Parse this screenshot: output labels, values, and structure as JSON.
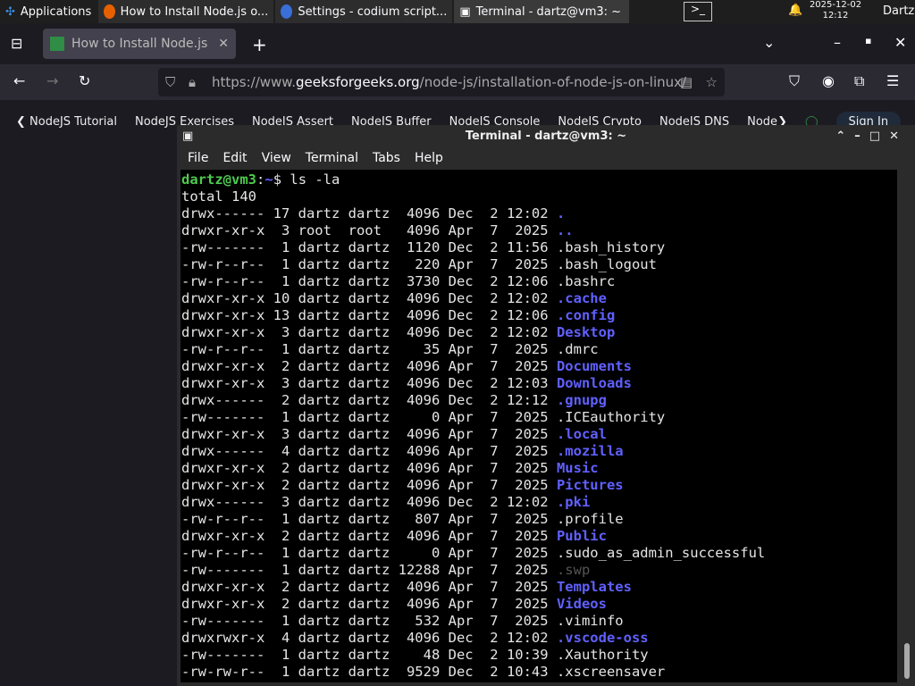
{
  "panel": {
    "apps": "Applications",
    "tasks": [
      "How to Install Node.js o...",
      "Settings - codium script...",
      "Terminal - dartz@vm3: ~"
    ],
    "date": "2025-12-02",
    "time": "12:12",
    "user": "Dartz"
  },
  "browser": {
    "tab_title": "How to Install Node.js or",
    "url_pre": "https://www.",
    "url_domain": "geeksforgeeks.org",
    "url_path": "/node-js/installation-of-node-js-on-linux/",
    "site_nav": [
      "NodeJS Tutorial",
      "NodeJS Exercises",
      "NodeJS Assert",
      "NodeJS Buffer",
      "NodeJS Console",
      "NodeJS Crypto",
      "NodeJS DNS",
      "Node"
    ],
    "sign_in": "Sign In"
  },
  "terminal": {
    "title": "Terminal - dartz@vm3: ~",
    "menu": [
      "File",
      "Edit",
      "View",
      "Terminal",
      "Tabs",
      "Help"
    ],
    "prompt_user": "dartz@vm3",
    "prompt_path": "~",
    "command": "ls -la",
    "total": "total 140",
    "colors": {
      "dir": "#6060ff",
      "prompt": "#4ec94e"
    },
    "rows": [
      {
        "meta": "drwx------ 17 dartz dartz  4096 Dec  2 12:02",
        "name": ".",
        "kind": "dir"
      },
      {
        "meta": "drwxr-xr-x  3 root  root   4096 Apr  7  2025",
        "name": "..",
        "kind": "dir"
      },
      {
        "meta": "-rw-------  1 dartz dartz  1120 Dec  2 11:56",
        "name": ".bash_history",
        "kind": "file"
      },
      {
        "meta": "-rw-r--r--  1 dartz dartz   220 Apr  7  2025",
        "name": ".bash_logout",
        "kind": "file"
      },
      {
        "meta": "-rw-r--r--  1 dartz dartz  3730 Dec  2 12:06",
        "name": ".bashrc",
        "kind": "file"
      },
      {
        "meta": "drwxr-xr-x 10 dartz dartz  4096 Dec  2 12:02",
        "name": ".cache",
        "kind": "dir"
      },
      {
        "meta": "drwxr-xr-x 13 dartz dartz  4096 Dec  2 12:06",
        "name": ".config",
        "kind": "dir"
      },
      {
        "meta": "drwxr-xr-x  3 dartz dartz  4096 Dec  2 12:02",
        "name": "Desktop",
        "kind": "dir"
      },
      {
        "meta": "-rw-r--r--  1 dartz dartz    35 Apr  7  2025",
        "name": ".dmrc",
        "kind": "file"
      },
      {
        "meta": "drwxr-xr-x  2 dartz dartz  4096 Apr  7  2025",
        "name": "Documents",
        "kind": "dir"
      },
      {
        "meta": "drwxr-xr-x  3 dartz dartz  4096 Dec  2 12:03",
        "name": "Downloads",
        "kind": "dir"
      },
      {
        "meta": "drwx------  2 dartz dartz  4096 Dec  2 12:12",
        "name": ".gnupg",
        "kind": "dir"
      },
      {
        "meta": "-rw-------  1 dartz dartz     0 Apr  7  2025",
        "name": ".ICEauthority",
        "kind": "file"
      },
      {
        "meta": "drwxr-xr-x  3 dartz dartz  4096 Apr  7  2025",
        "name": ".local",
        "kind": "dir"
      },
      {
        "meta": "drwx------  4 dartz dartz  4096 Apr  7  2025",
        "name": ".mozilla",
        "kind": "dir"
      },
      {
        "meta": "drwxr-xr-x  2 dartz dartz  4096 Apr  7  2025",
        "name": "Music",
        "kind": "dir"
      },
      {
        "meta": "drwxr-xr-x  2 dartz dartz  4096 Apr  7  2025",
        "name": "Pictures",
        "kind": "dir"
      },
      {
        "meta": "drwx------  3 dartz dartz  4096 Dec  2 12:02",
        "name": ".pki",
        "kind": "dir"
      },
      {
        "meta": "-rw-r--r--  1 dartz dartz   807 Apr  7  2025",
        "name": ".profile",
        "kind": "file"
      },
      {
        "meta": "drwxr-xr-x  2 dartz dartz  4096 Apr  7  2025",
        "name": "Public",
        "kind": "dir"
      },
      {
        "meta": "-rw-r--r--  1 dartz dartz     0 Apr  7  2025",
        "name": ".sudo_as_admin_successful",
        "kind": "file"
      },
      {
        "meta": "-rw-------  1 dartz dartz 12288 Apr  7  2025",
        "name": ".swp",
        "kind": "dim"
      },
      {
        "meta": "drwxr-xr-x  2 dartz dartz  4096 Apr  7  2025",
        "name": "Templates",
        "kind": "dir"
      },
      {
        "meta": "drwxr-xr-x  2 dartz dartz  4096 Apr  7  2025",
        "name": "Videos",
        "kind": "dir"
      },
      {
        "meta": "-rw-------  1 dartz dartz   532 Apr  7  2025",
        "name": ".viminfo",
        "kind": "file"
      },
      {
        "meta": "drwxrwxr-x  4 dartz dartz  4096 Dec  2 12:02",
        "name": ".vscode-oss",
        "kind": "dir"
      },
      {
        "meta": "-rw-------  1 dartz dartz    48 Dec  2 10:39",
        "name": ".Xauthority",
        "kind": "file"
      },
      {
        "meta": "-rw-rw-r--  1 dartz dartz  9529 Dec  2 10:43",
        "name": ".xscreensaver",
        "kind": "file"
      }
    ]
  }
}
